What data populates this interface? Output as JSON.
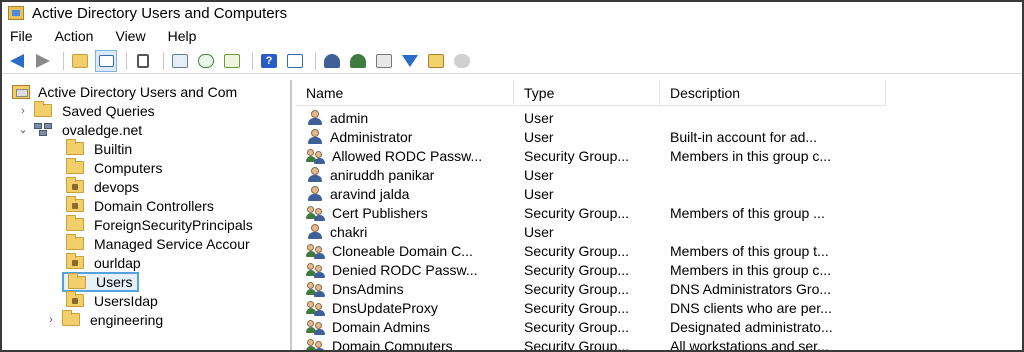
{
  "window": {
    "title": "Active Directory Users and Computers"
  },
  "menu": [
    "File",
    "Action",
    "View",
    "Help"
  ],
  "toolbar": [
    "back-arrow-icon",
    "forward-arrow-icon",
    "up-folder-icon",
    "console-tree-icon",
    "clipboard-icon",
    "properties-icon",
    "refresh-icon",
    "export-list-icon",
    "help-icon",
    "action-pane-icon",
    "new-user-icon",
    "new-group-icon",
    "new-ou-icon",
    "filter-icon",
    "add-to-group-icon",
    "delegate-icon"
  ],
  "tree": {
    "root": "Active Directory Users and Com",
    "items": [
      {
        "label": "Saved Queries",
        "level": 1,
        "expander": "›",
        "icon": "folder"
      },
      {
        "label": "ovaledge.net",
        "level": 1,
        "expander": "⌄",
        "icon": "domain"
      },
      {
        "label": "Builtin",
        "level": 2,
        "expander": "",
        "icon": "folder"
      },
      {
        "label": "Computers",
        "level": 2,
        "expander": "",
        "icon": "folder"
      },
      {
        "label": "devops",
        "level": 2,
        "expander": "",
        "icon": "ou"
      },
      {
        "label": "Domain Controllers",
        "level": 2,
        "expander": "",
        "icon": "ou"
      },
      {
        "label": "ForeignSecurityPrincipals",
        "level": 2,
        "expander": "",
        "icon": "folder"
      },
      {
        "label": "Managed Service Accour",
        "level": 2,
        "expander": "",
        "icon": "folder"
      },
      {
        "label": "ourldap",
        "level": 2,
        "expander": "",
        "icon": "ou"
      },
      {
        "label": "Users",
        "level": 2,
        "expander": "",
        "icon": "folder",
        "selected": true
      },
      {
        "label": "UsersIdap",
        "level": 2,
        "expander": "",
        "icon": "ou"
      },
      {
        "label": "engineering",
        "level": 2,
        "expander": "›",
        "icon": "folder"
      }
    ]
  },
  "list": {
    "columns": [
      "Name",
      "Type",
      "Description"
    ],
    "rows": [
      {
        "name": "admin",
        "type": "User",
        "description": "",
        "icon": "user"
      },
      {
        "name": "Administrator",
        "type": "User",
        "description": "Built-in account for ad...",
        "icon": "user"
      },
      {
        "name": "Allowed RODC Passw...",
        "type": "Security Group...",
        "description": "Members in this group c...",
        "icon": "group"
      },
      {
        "name": "aniruddh panikar",
        "type": "User",
        "description": "",
        "icon": "user"
      },
      {
        "name": "aravind jalda",
        "type": "User",
        "description": "",
        "icon": "user"
      },
      {
        "name": "Cert Publishers",
        "type": "Security Group...",
        "description": "Members of this group ...",
        "icon": "group"
      },
      {
        "name": "chakri",
        "type": "User",
        "description": "",
        "icon": "user"
      },
      {
        "name": "Cloneable Domain C...",
        "type": "Security Group...",
        "description": "Members of this group t...",
        "icon": "group"
      },
      {
        "name": "Denied RODC Passw...",
        "type": "Security Group...",
        "description": "Members in this group c...",
        "icon": "group"
      },
      {
        "name": "DnsAdmins",
        "type": "Security Group...",
        "description": "DNS Administrators Gro...",
        "icon": "group"
      },
      {
        "name": "DnsUpdateProxy",
        "type": "Security Group...",
        "description": "DNS clients who are per...",
        "icon": "group"
      },
      {
        "name": "Domain Admins",
        "type": "Security Group...",
        "description": "Designated administrato...",
        "icon": "group"
      },
      {
        "name": "Domain Computers",
        "type": "Security Group...",
        "description": "All workstations and ser...",
        "icon": "group"
      }
    ]
  }
}
